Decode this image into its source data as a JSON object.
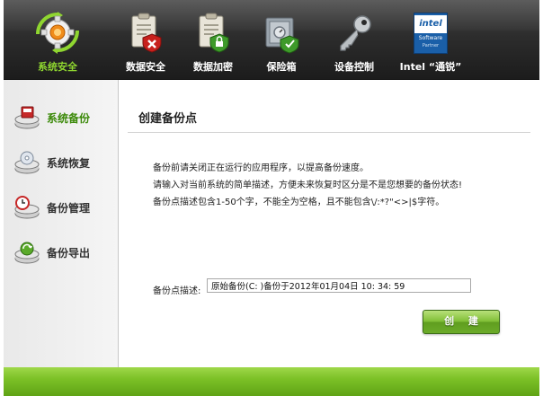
{
  "toolbar": {
    "items": [
      {
        "label": "系统安全",
        "icon": "shield-gear-icon"
      },
      {
        "label": "数据安全",
        "icon": "document-shield-red-icon"
      },
      {
        "label": "数据加密",
        "icon": "document-lock-icon"
      },
      {
        "label": "保险箱",
        "icon": "safe-icon"
      },
      {
        "label": "设备控制",
        "icon": "key-icon"
      },
      {
        "label": "Intel “通锐”",
        "icon": "intel-software-logo-icon"
      }
    ],
    "active_index": 0,
    "intel_logo": {
      "brand": "intel",
      "line1": "Software",
      "line2": "Partner"
    }
  },
  "sidebar": {
    "items": [
      {
        "label": "系统备份",
        "icon": "disk-backup-icon"
      },
      {
        "label": "系统恢复",
        "icon": "disk-restore-icon"
      },
      {
        "label": "备份管理",
        "icon": "disk-clock-icon"
      },
      {
        "label": "备份导出",
        "icon": "disk-export-icon"
      }
    ],
    "active_index": 0
  },
  "main": {
    "title": "创建备份点",
    "notes": [
      "备份前请关闭正在运行的应用程序，以提高备份速度。",
      "请输入对当前系统的简单描述，方便未来恢复时区分是不是您想要的备份状态!",
      "备份点描述包含1-50个字，不能全为空格，且不能包含\\/:*?\"<>|$字符。"
    ],
    "field_label": "备份点描述:",
    "field_value": "原始备份(C: )备份于2012年01月04日 10: 34: 59",
    "create_button": "创  建"
  },
  "colors": {
    "accent_green": "#7cc127",
    "active_label": "#8fd630",
    "toolbar_bg": "#2d2d2d"
  }
}
